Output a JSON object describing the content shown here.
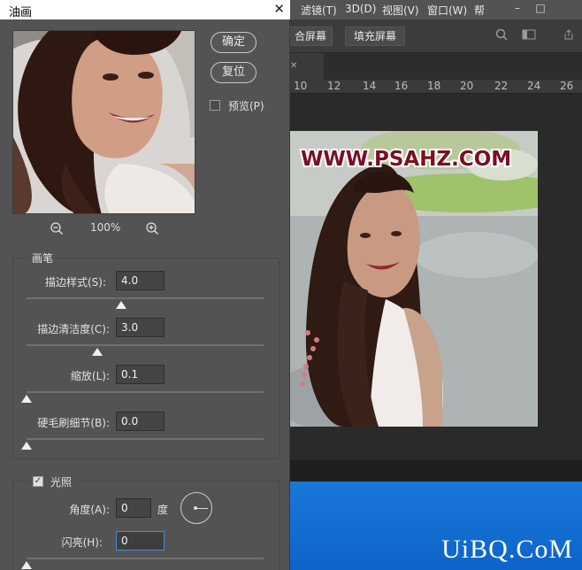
{
  "dialog": {
    "title": "油画",
    "ok_label": "确定",
    "reset_label": "复位",
    "preview_label": "预览(P)",
    "zoom_level": "100%"
  },
  "brush": {
    "title": "画笔",
    "stylization": {
      "label": "描边样式(S):",
      "value": "4.0",
      "fraction": 0.4
    },
    "cleanliness": {
      "label": "描边清洁度(C):",
      "value": "3.0",
      "fraction": 0.3
    },
    "scale": {
      "label": "缩放(L):",
      "value": "0.1",
      "fraction": 0.0
    },
    "bristle": {
      "label": "硬毛刷细节(B):",
      "value": "0.0",
      "fraction": 0.0
    }
  },
  "lighting": {
    "title": "光照",
    "checked": true,
    "angle": {
      "label": "角度(A):",
      "value": "0",
      "unit": "度"
    },
    "shine": {
      "label": "闪亮(H):",
      "value": "0"
    }
  },
  "ps": {
    "menu": [
      "滤镜(T)",
      "3D(D)",
      "视图(V)",
      "窗口(W)",
      "帮"
    ],
    "opt_buttons": [
      "合屏幕",
      "填充屏幕"
    ],
    "ruler": [
      "10",
      "12",
      "14",
      "16",
      "18",
      "20",
      "22",
      "24",
      "26"
    ],
    "doc_text": "WWW.PSAHZ.COM",
    "watermark": "UiBQ.CoM",
    "window_controls": [
      "–",
      "□"
    ]
  },
  "colors": {
    "dialog_bg": "#535353",
    "ps_menubar": "#535353",
    "desktop_blue": "#1a77d9",
    "doc_text_color": "#7b0f23"
  }
}
